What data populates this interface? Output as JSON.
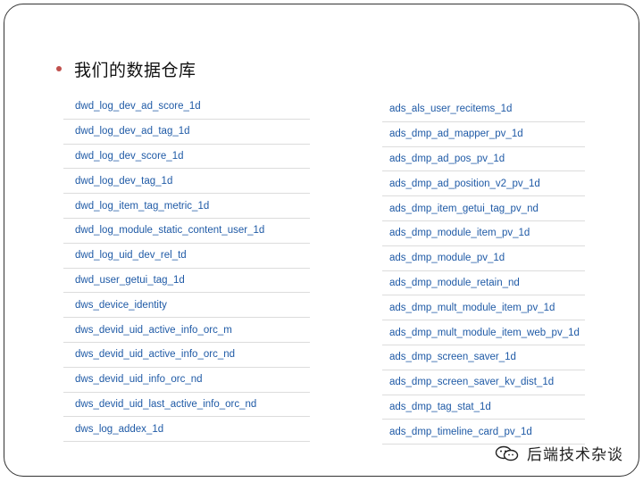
{
  "slide": {
    "title": "我们的数据仓库",
    "bullet_color": "#c0504d",
    "link_color": "#1f5aa6",
    "left_tables": [
      "dwd_log_dev_ad_score_1d",
      "dwd_log_dev_ad_tag_1d",
      "dwd_log_dev_score_1d",
      "dwd_log_dev_tag_1d",
      "dwd_log_item_tag_metric_1d",
      "dwd_log_module_static_content_user_1d",
      "dwd_log_uid_dev_rel_td",
      "dwd_user_getui_tag_1d",
      "dws_device_identity",
      "dws_devid_uid_active_info_orc_m",
      "dws_devid_uid_active_info_orc_nd",
      "dws_devid_uid_info_orc_nd",
      "dws_devid_uid_last_active_info_orc_nd",
      "dws_log_addex_1d"
    ],
    "right_tables": [
      "ads_als_user_recitems_1d",
      "ads_dmp_ad_mapper_pv_1d",
      "ads_dmp_ad_pos_pv_1d",
      "ads_dmp_ad_position_v2_pv_1d",
      "ads_dmp_item_getui_tag_pv_nd",
      "ads_dmp_module_item_pv_1d",
      "ads_dmp_module_pv_1d",
      "ads_dmp_module_retain_nd",
      "ads_dmp_mult_module_item_pv_1d",
      "ads_dmp_mult_module_item_web_pv_1d",
      "ads_dmp_screen_saver_1d",
      "ads_dmp_screen_saver_kv_dist_1d",
      "ads_dmp_tag_stat_1d",
      "ads_dmp_timeline_card_pv_1d"
    ]
  },
  "watermark": {
    "icon": "wechat-logo-icon",
    "text": "后端技术杂谈"
  }
}
